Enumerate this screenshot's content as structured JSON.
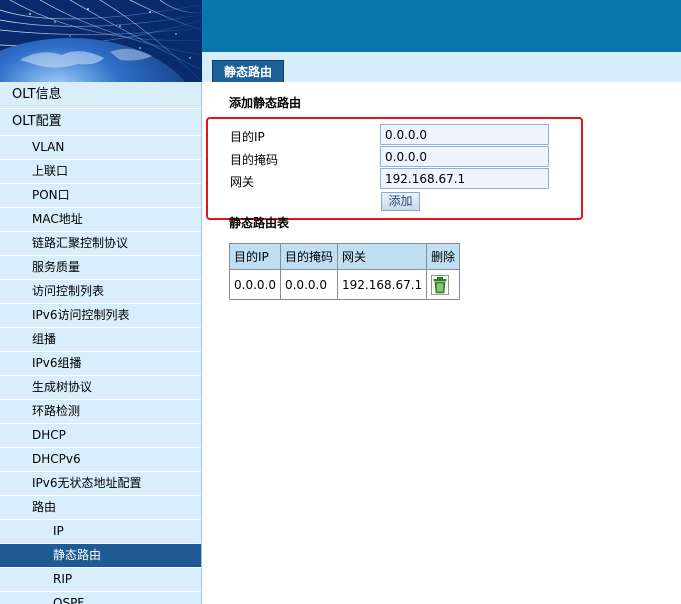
{
  "header": {
    "tab_label": "静态路由"
  },
  "sidebar": {
    "items": [
      {
        "label": "OLT信息",
        "level": 0,
        "name": "sidebar-item-olt-info"
      },
      {
        "label": "OLT配置",
        "level": 0,
        "name": "sidebar-item-olt-config"
      },
      {
        "label": "VLAN",
        "level": 1,
        "name": "sidebar-item-vlan"
      },
      {
        "label": "上联口",
        "level": 1,
        "name": "sidebar-item-uplink"
      },
      {
        "label": "PON口",
        "level": 1,
        "name": "sidebar-item-pon"
      },
      {
        "label": "MAC地址",
        "level": 1,
        "name": "sidebar-item-mac"
      },
      {
        "label": "链路汇聚控制协议",
        "level": 1,
        "name": "sidebar-item-lacp"
      },
      {
        "label": "服务质量",
        "level": 1,
        "name": "sidebar-item-qos"
      },
      {
        "label": "访问控制列表",
        "level": 1,
        "name": "sidebar-item-acl"
      },
      {
        "label": "IPv6访问控制列表",
        "level": 1,
        "name": "sidebar-item-ipv6-acl"
      },
      {
        "label": "组播",
        "level": 1,
        "name": "sidebar-item-multicast"
      },
      {
        "label": "IPv6组播",
        "level": 1,
        "name": "sidebar-item-ipv6-multicast"
      },
      {
        "label": "生成树协议",
        "level": 1,
        "name": "sidebar-item-stp"
      },
      {
        "label": "环路检测",
        "level": 1,
        "name": "sidebar-item-loop-detect"
      },
      {
        "label": "DHCP",
        "level": 1,
        "name": "sidebar-item-dhcp"
      },
      {
        "label": "DHCPv6",
        "level": 1,
        "name": "sidebar-item-dhcpv6"
      },
      {
        "label": "IPv6无状态地址配置",
        "level": 1,
        "name": "sidebar-item-ipv6-slaac"
      },
      {
        "label": "路由",
        "level": 1,
        "name": "sidebar-item-routing"
      },
      {
        "label": "IP",
        "level": 2,
        "name": "sidebar-item-ip"
      },
      {
        "label": "静态路由",
        "level": 2,
        "name": "sidebar-item-static-route",
        "active": true
      },
      {
        "label": "RIP",
        "level": 2,
        "name": "sidebar-item-rip"
      },
      {
        "label": "OSPF",
        "level": 2,
        "name": "sidebar-item-ospf"
      }
    ]
  },
  "form": {
    "title": "添加静态路由",
    "dest_ip_label": "目的IP",
    "dest_ip_value": "0.0.0.0",
    "dest_mask_label": "目的掩码",
    "dest_mask_value": "0.0.0.0",
    "gateway_label": "网关",
    "gateway_value": "192.168.67.1",
    "add_button": "添加"
  },
  "table": {
    "title": "静态路由表",
    "headers": [
      "目的IP",
      "目的掩码",
      "网关",
      "删除"
    ],
    "rows": [
      {
        "dest_ip": "0.0.0.0",
        "dest_mask": "0.0.0.0",
        "gateway": "192.168.67.1",
        "delete_icon": "trash-icon"
      }
    ]
  },
  "colors": {
    "banner": "#0a76ae",
    "sidebar_bg": "#d8eefb",
    "active_item": "#1e5b94",
    "highlight_border": "#e0161b",
    "table_header": "#bfe0f4"
  }
}
